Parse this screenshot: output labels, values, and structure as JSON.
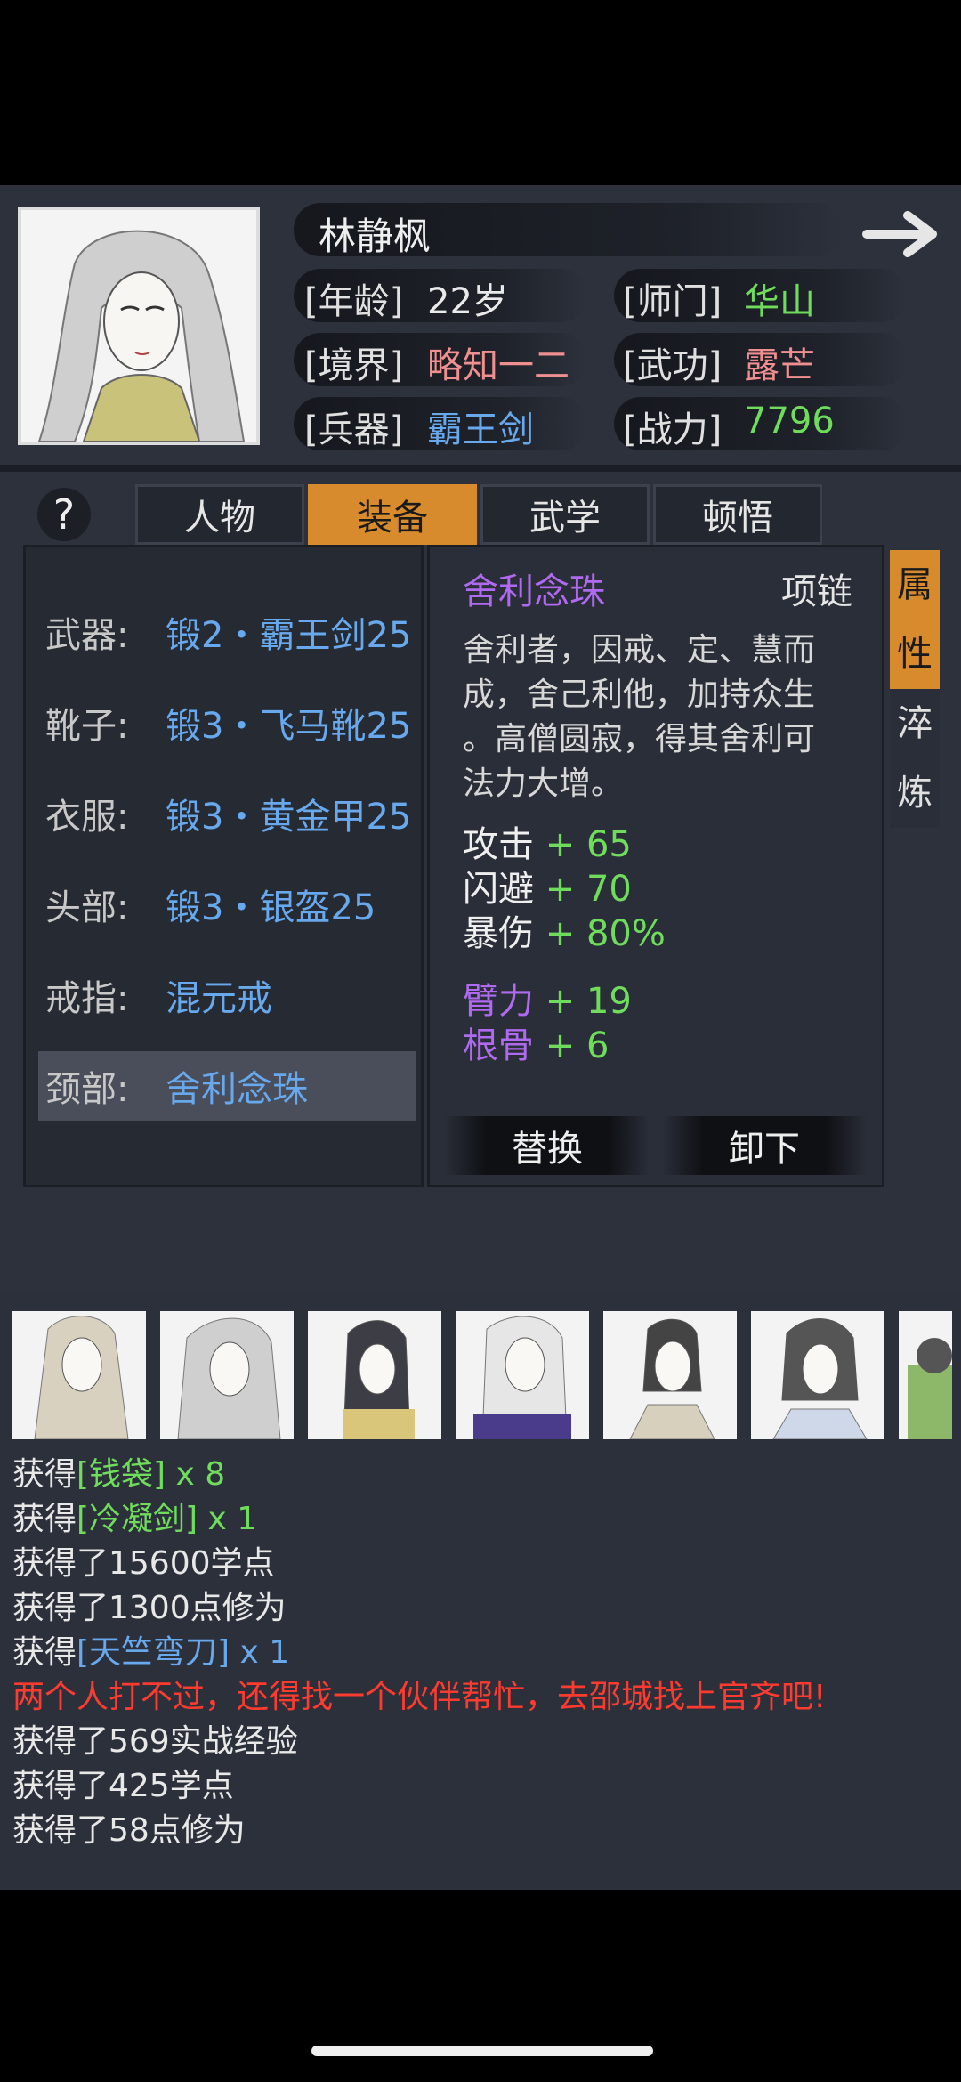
{
  "character": {
    "name": "林静枫",
    "age_label": "[年龄]",
    "age": "22岁",
    "sect_label": "[师门]",
    "sect": "华山",
    "realm_label": "[境界]",
    "realm": "略知一二",
    "skill_label": "[武功]",
    "skill": "露芒",
    "weapon_label": "[兵器]",
    "weapon": "霸王剑",
    "power_label": "[战力]",
    "power": "7796"
  },
  "help_label": "?",
  "tabs": [
    "人物",
    "装备",
    "武学",
    "顿悟"
  ],
  "active_tab": "装备",
  "equipment": [
    {
      "slot": "武器:",
      "name": "锻2・霸王剑25"
    },
    {
      "slot": "靴子:",
      "name": "锻3・飞马靴25"
    },
    {
      "slot": "衣服:",
      "name": "锻3・黄金甲25"
    },
    {
      "slot": "头部:",
      "name": "锻3・银盔25"
    },
    {
      "slot": "戒指:",
      "name": "混元戒"
    },
    {
      "slot": "颈部:",
      "name": "舍利念珠"
    }
  ],
  "detail": {
    "item_name": "舍利念珠",
    "item_type": "项链",
    "description": [
      "舍利者，因戒、定、慧而",
      "成，舍己利他，加持众生",
      "。高僧圆寂，得其舍利可",
      "法力大增。"
    ],
    "stats": [
      {
        "name": "攻击",
        "value": "+ 65"
      },
      {
        "name": "闪避",
        "value": "+ 70"
      },
      {
        "name": "暴伤",
        "value": "+ 80%"
      }
    ],
    "bonus_stats": [
      {
        "name": "臂力",
        "value": "+ 19"
      },
      {
        "name": "根骨",
        "value": "+ 6"
      }
    ],
    "replace_label": "替换",
    "unequip_label": "卸下"
  },
  "side_tabs": [
    {
      "label1": "属",
      "label2": "性"
    },
    {
      "label1": "淬",
      "label2": "炼"
    }
  ],
  "log": [
    {
      "prefix": "获得",
      "item": "[钱袋]",
      "suffix": " x 8",
      "color": "#6fdc5c"
    },
    {
      "prefix": "获得",
      "item": "[冷凝剑]",
      "suffix": " x 1",
      "color": "#6fdc5c"
    },
    {
      "text": "获得了15600学点"
    },
    {
      "text": "获得了1300点修为"
    },
    {
      "prefix": "获得",
      "item": "[天竺弯刀]",
      "suffix": " x 1",
      "color": "#68a8ec"
    },
    {
      "text": "两个人打不过，还得找一个伙伴帮忙，去邵城找上官齐吧!",
      "color": "#ff3b30"
    },
    {
      "text": "获得了569实战经验"
    },
    {
      "text": "获得了425学点"
    },
    {
      "text": "获得了58点修为"
    }
  ]
}
